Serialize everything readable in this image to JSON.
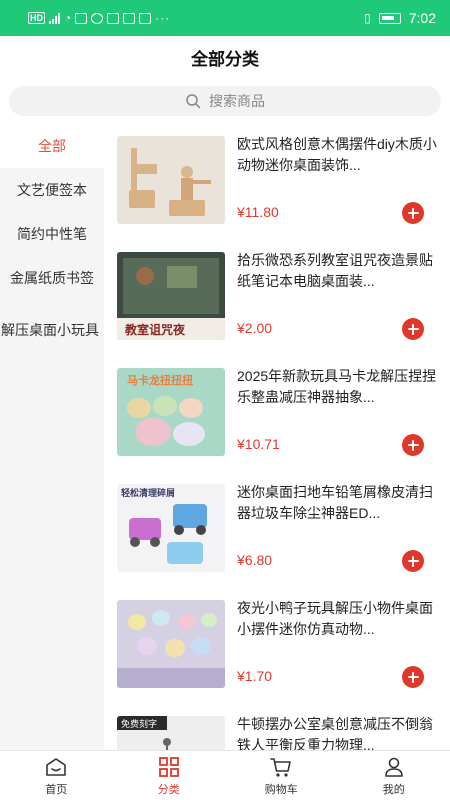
{
  "status_bar": {
    "time": "7:02",
    "left_text": "HD",
    "colors": {
      "bg": "#1fc978"
    }
  },
  "header": {
    "title": "全部分类"
  },
  "search": {
    "placeholder": "搜索商品",
    "icon": "search-icon"
  },
  "sidebar": {
    "items": [
      {
        "label": "全部",
        "active": true
      },
      {
        "label": "文艺便签本",
        "active": false
      },
      {
        "label": "简约中性笔",
        "active": false
      },
      {
        "label": "金属纸质书签",
        "active": false
      },
      {
        "label": "解压桌面小玩具",
        "active": false
      }
    ]
  },
  "products": [
    {
      "title": "欧式风格创意木偶摆件diy木质小动物迷你桌面装饰...",
      "price": "¥11.80"
    },
    {
      "title": "拾乐微恐系列教室诅咒夜造景贴纸笔记本电脑桌面装...",
      "price": "¥2.00",
      "image_text": "教室诅咒夜"
    },
    {
      "title": "2025年新款玩具马卡龙解压捏捏乐整蛊减压神器抽象...",
      "price": "¥10.71",
      "image_text": "马卡龙扭扭扭"
    },
    {
      "title": "迷你桌面扫地车铅笔屑橡皮清扫器垃圾车除尘神器ED...",
      "price": "¥6.80",
      "image_text": "轻松清理碎屑"
    },
    {
      "title": "夜光小鸭子玩具解压小物件桌面小摆件迷你仿真动物...",
      "price": "¥1.70"
    },
    {
      "title": "牛顿摆办公室桌创意减压不倒翁铁人平衡反重力物理...",
      "price": "",
      "image_text": "免费刻字"
    }
  ],
  "bottom_nav": [
    {
      "label": "首页",
      "icon": "home-icon",
      "active": false
    },
    {
      "label": "分类",
      "icon": "category-icon",
      "active": true
    },
    {
      "label": "购物车",
      "icon": "cart-icon",
      "active": false
    },
    {
      "label": "我的",
      "icon": "user-icon",
      "active": false
    }
  ],
  "colors": {
    "accent": "#e1372b",
    "status_bar": "#1fc978",
    "sidebar_bg": "#f5f5f5"
  }
}
